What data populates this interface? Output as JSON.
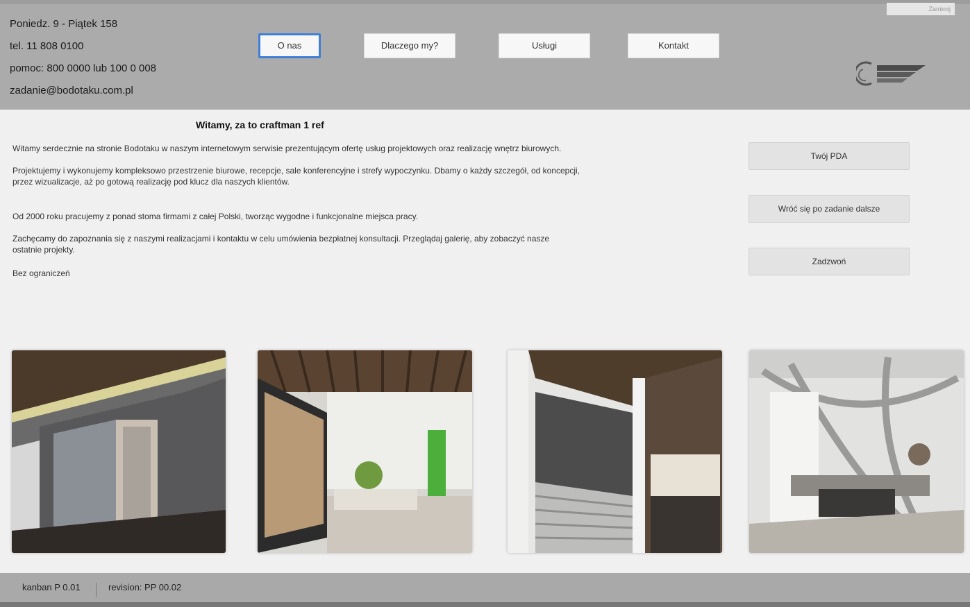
{
  "header": {
    "contact": [
      "Poniedz. 9 - Piątek 158",
      "tel. 11 808 0100",
      "pomoc: 800 0000 lub 100 0 008",
      "zadanie@bodotaku.com.pl"
    ],
    "nav": [
      {
        "label": "O nas",
        "active": true
      },
      {
        "label": "Dlaczego my?",
        "active": false
      },
      {
        "label": "Usługi",
        "active": false
      },
      {
        "label": "Kontakt",
        "active": false
      }
    ],
    "window_label": "Zamknij"
  },
  "intro": {
    "title": "Witamy, za to craftman 1 ref",
    "paragraphs": [
      "Witamy serdecznie na stronie Bodotaku w naszym internetowym serwisie prezentującym ofertę usług projektowych oraz realizację wnętrz biurowych.",
      "Projektujemy i wykonujemy kompleksowo przestrzenie biurowe, recepcje, sale konferencyjne i strefy wypoczynku. Dbamy o każdy szczegół, od koncepcji, przez wizualizacje, aż po gotową realizację pod klucz dla naszych klientów.",
      "Od 2000 roku pracujemy z ponad stoma firmami z całej Polski, tworząc wygodne i funkcjonalne miejsca pracy.",
      "Zachęcamy do zapoznania się z naszymi realizacjami i kontaktu w celu umówienia bezpłatnej konsultacji. Przeglądaj galerię, aby zobaczyć nasze ostatnie projekty.",
      "Bez ograniczeń"
    ]
  },
  "side_buttons": [
    "Twój PDA",
    "Wróć się po zadanie dalsze",
    "Zadzwoń"
  ],
  "photos": [
    {
      "icon": "office-corridor-photo"
    },
    {
      "icon": "reception-photo"
    },
    {
      "icon": "staircase-photo"
    },
    {
      "icon": "lounge-photo"
    }
  ],
  "footer": {
    "left": "kanban P 0.01",
    "right": "revision: PP 00.02"
  }
}
